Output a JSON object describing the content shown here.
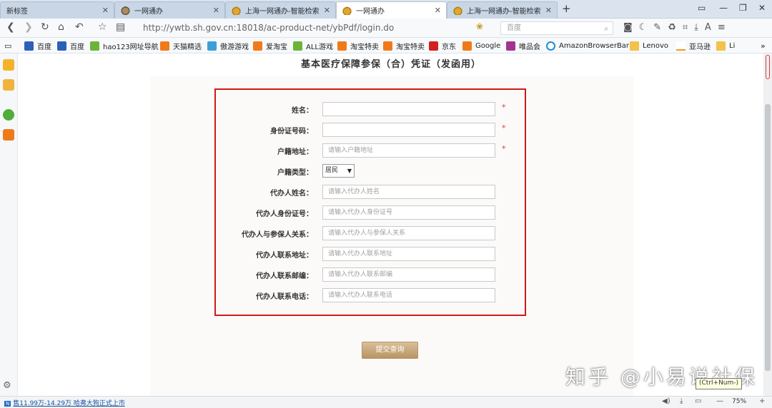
{
  "tabs": [
    {
      "label": "新标签",
      "icon": "none"
    },
    {
      "label": "一网通办",
      "icon": "brown"
    },
    {
      "label": "上海一网通办-智能检索",
      "icon": "gold"
    },
    {
      "label": "一网通办",
      "icon": "gold",
      "active": true
    },
    {
      "label": "上海一网通办-智能检索",
      "icon": "gold"
    }
  ],
  "address": {
    "url": "http://ywtb.sh.gov.cn:18018/ac-product-net/ybPdf/login.do",
    "search_placeholder": "百度"
  },
  "bookmarks": [
    {
      "label": "百度",
      "icon": "blue"
    },
    {
      "label": "百度",
      "icon": "blue"
    },
    {
      "label": "hao123网址导航",
      "icon": "green"
    },
    {
      "label": "天猫精选",
      "icon": "orange"
    },
    {
      "label": "傲游游戏",
      "icon": "cyan"
    },
    {
      "label": "爱淘宝",
      "icon": "orange"
    },
    {
      "label": "ALL游戏",
      "icon": "green"
    },
    {
      "label": "淘宝特卖",
      "icon": "orange"
    },
    {
      "label": "淘宝特卖",
      "icon": "orange"
    },
    {
      "label": "京东",
      "icon": "red"
    },
    {
      "label": "Google",
      "icon": "orange"
    },
    {
      "label": "唯品会",
      "icon": "purple"
    },
    {
      "label": "AmazonBrowserBar",
      "icon": "ie"
    },
    {
      "label": "Lenovo",
      "icon": "folder"
    },
    {
      "label": "亚马逊",
      "icon": "amz"
    },
    {
      "label": "Li",
      "icon": "folder"
    }
  ],
  "page": {
    "title": "基本医疗保障参保（合）凭证（发函用）",
    "form": [
      {
        "label": "姓名：",
        "placeholder": "",
        "required": true
      },
      {
        "label": "身份证号码：",
        "placeholder": "",
        "required": true
      },
      {
        "label": "户籍地址：",
        "placeholder": "请输入户籍地址",
        "required": true
      },
      {
        "label": "户籍类型：",
        "select": "居民"
      },
      {
        "label": "代办人姓名：",
        "placeholder": "请输入代办人姓名"
      },
      {
        "label": "代办人身份证号：",
        "placeholder": "请输入代办人身份证号"
      },
      {
        "label": "代办人与参保人关系：",
        "placeholder": "请输入代办人与参保人关系"
      },
      {
        "label": "代办人联系地址：",
        "placeholder": "请输入代办人联系地址"
      },
      {
        "label": "代办人联系邮编：",
        "placeholder": "请输入代办人联系邮编"
      },
      {
        "label": "代办人联系电话：",
        "placeholder": "请输入代办人联系电话"
      }
    ],
    "required_mark": "*",
    "submit_label": "提交查询"
  },
  "watermark": "知乎 @小易说社保",
  "tooltip": "(Ctrl+Num-)",
  "status": {
    "badge": "N",
    "ad_text": "售11.99万-14.29万 哈弗大狗正式上市",
    "zoom": "75%"
  },
  "colors": {
    "highlight_border": "#cc1a1a",
    "required": "#e23a3a",
    "submit": "#c9a77a"
  }
}
